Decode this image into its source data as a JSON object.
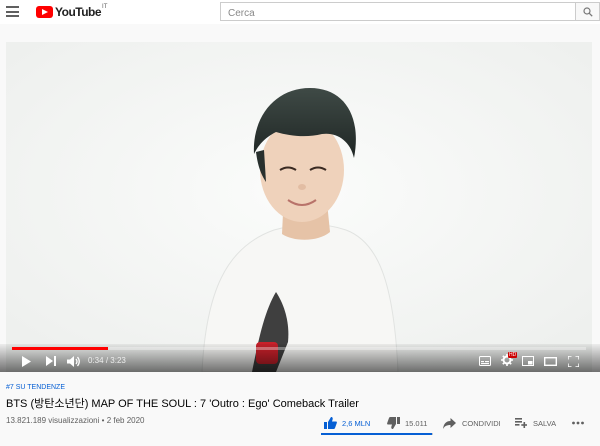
{
  "header": {
    "logo_text": "YouTube",
    "country_code": "IT",
    "search_placeholder": "Cerca"
  },
  "player": {
    "current_time": "0:34",
    "duration": "3:23",
    "time_separator": "/",
    "progress_fraction": 0.168,
    "badge_hd": "HD"
  },
  "video": {
    "trending_label": "#7 SU TENDENZE",
    "title": "BTS (방탄소년단) MAP OF THE SOUL : 7 'Outro : Ego' Comeback Trailer",
    "views": "13.821.189 visualizzazioni",
    "separator": "•",
    "date": "2 feb 2020"
  },
  "actions": {
    "likes": "2,6 MLN",
    "dislikes": "15.011",
    "share_label": "CONDIVIDI",
    "save_label": "SALVA",
    "like_ratio": 0.994
  },
  "colors": {
    "brand_red": "#ff0000",
    "accent_blue": "#065fd4"
  }
}
